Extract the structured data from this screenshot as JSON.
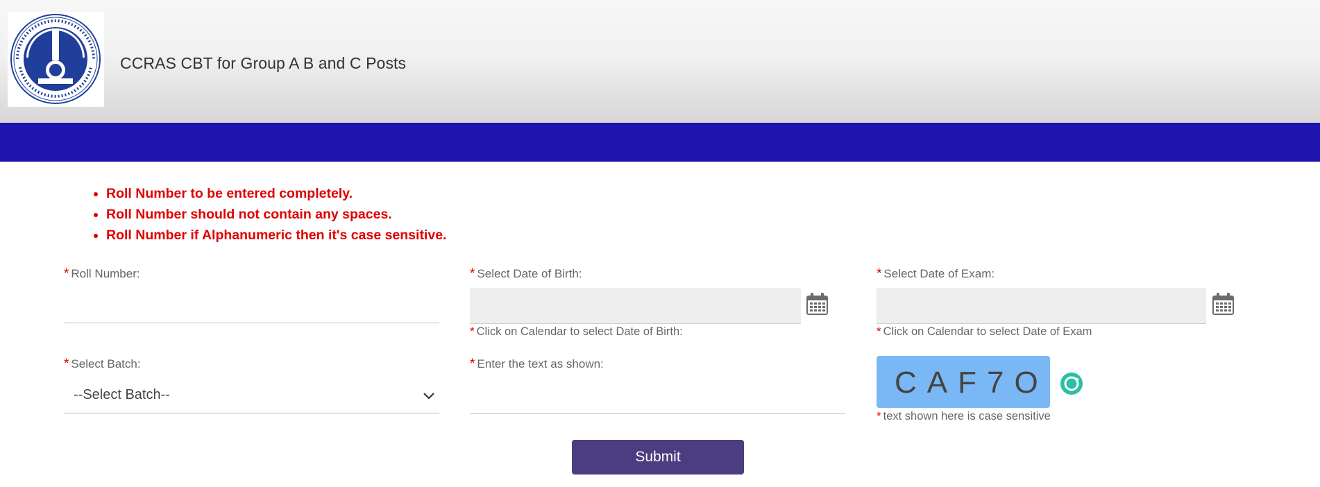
{
  "header": {
    "title": "CCRAS CBT for Group A B and C Posts",
    "logo_icon": "ccras-emblem-logo"
  },
  "colors": {
    "accent_bar": "#1c14ad",
    "error_text": "#e00000",
    "submit_button": "#4b3d80",
    "captcha_bg": "#7ab8f5",
    "refresh_icon": "#2bbfa6"
  },
  "notes": [
    "Roll Number to be entered completely.",
    "Roll Number should not contain any spaces.",
    "Roll Number if Alphanumeric then it's case sensitive."
  ],
  "form": {
    "required_mark": "*",
    "roll_number": {
      "label": "Roll Number:",
      "value": ""
    },
    "dob": {
      "label": "Select Date of Birth:",
      "value": "",
      "hint": "Click on Calendar to select Date of Birth:",
      "icon": "calendar-icon"
    },
    "exam_date": {
      "label": "Select Date of Exam:",
      "value": "",
      "hint": "Click on Calendar to select Date of Exam",
      "icon": "calendar-icon"
    },
    "batch": {
      "label": "Select Batch:",
      "selected": "--Select Batch--"
    },
    "captcha_input": {
      "label": "Enter the text as shown:",
      "value": ""
    },
    "captcha": {
      "text": "CAF7O",
      "hint": "text shown here is case sensitive",
      "refresh_icon": "refresh-icon"
    },
    "submit_label": "Submit"
  }
}
